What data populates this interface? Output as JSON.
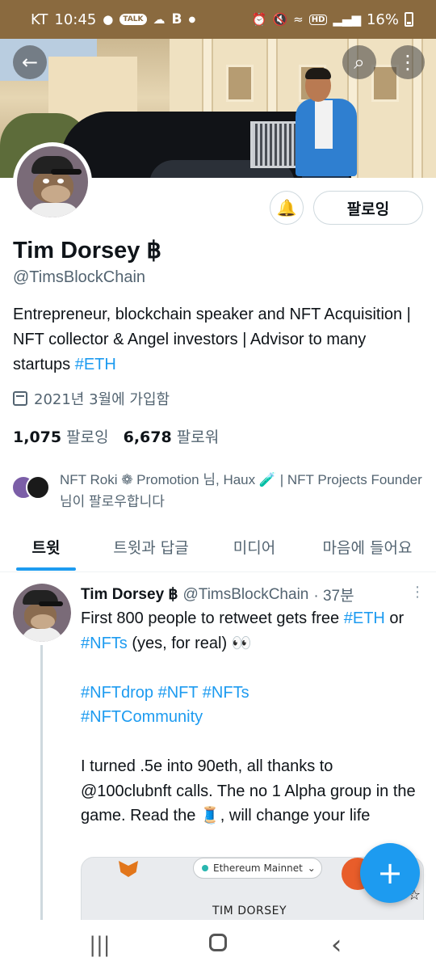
{
  "status_bar": {
    "carrier": "KT",
    "time": "10:45",
    "left_icons": [
      "chat-bubble-icon",
      "talk-icon",
      "cloud-icon",
      "b-icon",
      "dot-icon"
    ],
    "talk_label": "TALK",
    "b_label": "B",
    "hd_label": "HD",
    "battery": "16%"
  },
  "header": {
    "back_icon": "←",
    "search_icon": "⌕",
    "more_icon": "⋮"
  },
  "profile": {
    "name": "Tim Dorsey ฿",
    "handle": "@TimsBlockChain",
    "bio_text": "Entrepreneur, blockchain speaker and NFT Acquisition | NFT collector & Angel investors | Advisor to many startups ",
    "bio_hashtag": "#ETH",
    "joined": "2021년 3월에 가입함",
    "following_count": "1,075",
    "following_label": "팔로잉",
    "followers_count": "6,678",
    "followers_label": "팔로워",
    "known_followers": "NFT Roki ❁ Promotion 님, Haux 🧪 | NFT Projects Founder 님이 팔로우합니다",
    "follow_button": "팔로잉",
    "bell_icon": "🔔"
  },
  "tabs": [
    {
      "label": "트윗",
      "active": true
    },
    {
      "label": "트윗과 답글",
      "active": false
    },
    {
      "label": "미디어",
      "active": false
    },
    {
      "label": "마음에 들어요",
      "active": false
    }
  ],
  "tweet": {
    "author_name": "Tim Dorsey ฿",
    "author_handle": "@TimsBlockChain",
    "time": "· 37분",
    "more_icon": "⋮",
    "line1_text": "First 800 people to retweet gets free ",
    "line1_tag1": "#ETH",
    "line1_or": " or ",
    "line1_tag2": "#NFTs",
    "line1_tail": " (yes, for real) 👀",
    "hashtags_line1": "#NFTdrop #NFT #NFTs",
    "hashtags_line2": "#NFTCommunity",
    "para": "I turned .5e into 90eth, all thanks to @100clubnft calls. The no 1 Alpha group in the game. Read the 🧵, will change your life",
    "media": {
      "network": "Ethereum Mainnet",
      "network_chevron": "⌄",
      "account_name": "TIM DORSEY",
      "star_icon": "☆"
    }
  },
  "fab_label": "+",
  "navbar": {
    "recents_icon": "|||",
    "home_icon": "home",
    "back_icon": "‹"
  },
  "colors": {
    "accent": "#1d9bf0",
    "text": "#0f1419",
    "secondary": "#536471",
    "statusbar": "#8a6a3f"
  }
}
